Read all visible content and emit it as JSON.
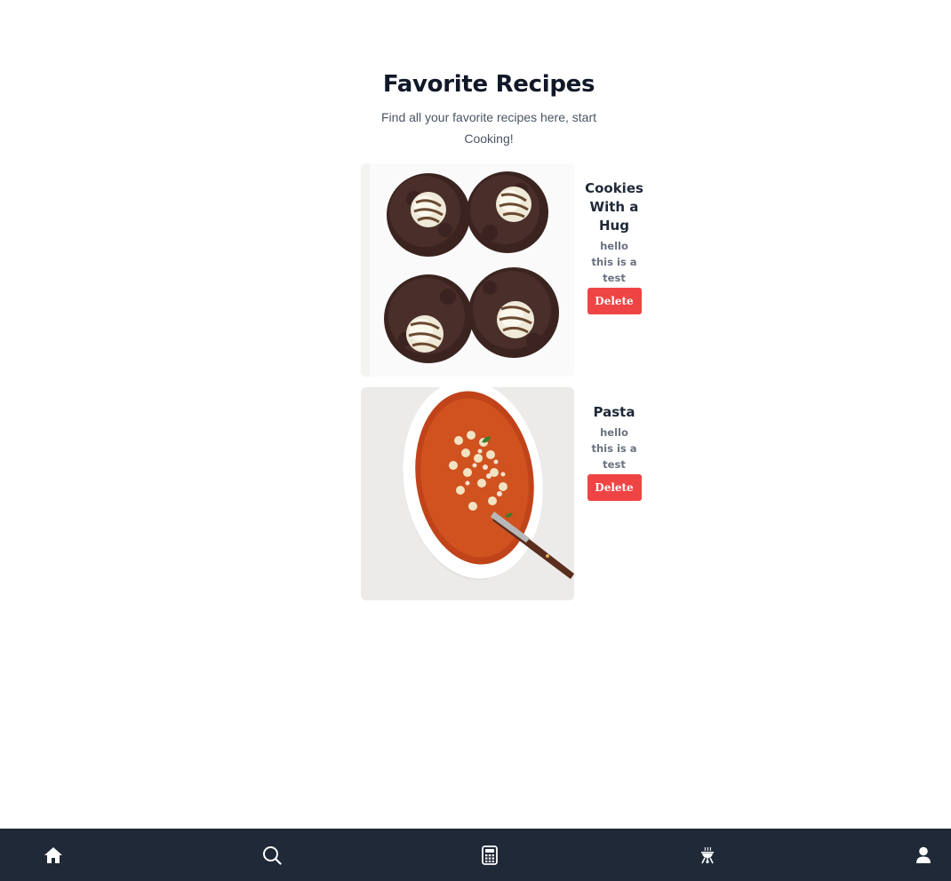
{
  "header": {
    "title": "Favorite Recipes",
    "subtitle": "Find all your favorite recipes here, start Cooking!"
  },
  "recipes": [
    {
      "name": "Cookies With a Hug",
      "description": "hello this is a test",
      "delete_label": "Delete",
      "image": "chocolate-cookies-with-hug-kisses"
    },
    {
      "name": "Pasta",
      "description": "hello this is a test",
      "delete_label": "Delete",
      "image": "pasta-soup-bowl-with-spoon"
    }
  ],
  "bottom_nav": {
    "items": [
      {
        "icon": "home-icon"
      },
      {
        "icon": "search-icon"
      },
      {
        "icon": "calculator-icon"
      },
      {
        "icon": "grill-icon"
      },
      {
        "icon": "user-icon"
      }
    ]
  },
  "colors": {
    "nav_background": "#1f2937",
    "delete_button": "#ef4444",
    "title_text": "#111827"
  }
}
